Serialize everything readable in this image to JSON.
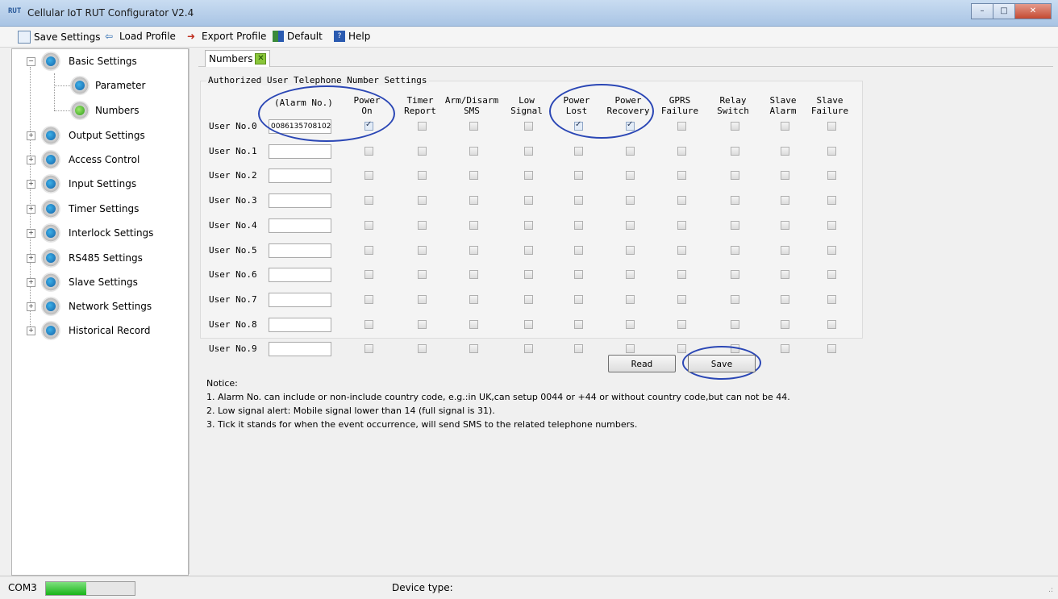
{
  "window": {
    "title": "Cellular IoT RUT Configurator V2.4",
    "min": "–",
    "max": "□",
    "close": "✕"
  },
  "menu": {
    "save_settings": "Save Settings",
    "load_profile": "Load Profile",
    "export_profile": "Export Profile",
    "default": "Default",
    "help": "Help"
  },
  "tree": {
    "basic_settings": "Basic Settings",
    "parameter": "Parameter",
    "numbers": "Numbers",
    "output_settings": "Output Settings",
    "access_control": "Access Control",
    "input_settings": "Input Settings",
    "timer_settings": "Timer Settings",
    "interlock_settings": "Interlock Settings",
    "rs485_settings": "RS485 Settings",
    "slave_settings": "Slave Settings",
    "network_settings": "Network Settings",
    "historical_record": "Historical Record"
  },
  "tab": {
    "label": "Numbers"
  },
  "form": {
    "group_title": "Authorized User Telephone Number Settings",
    "alarm_header": "(Alarm No.)",
    "columns": [
      [
        "Power",
        "On"
      ],
      [
        "Timer",
        "Report"
      ],
      [
        "Arm/Disarm",
        "SMS"
      ],
      [
        "Low",
        "Signal"
      ],
      [
        "Power",
        "Lost"
      ],
      [
        "Power",
        "Recovery"
      ],
      [
        "GPRS",
        "Failure"
      ],
      [
        "Relay",
        "Switch"
      ],
      [
        "Slave",
        "Alarm"
      ],
      [
        "Slave",
        "Failure"
      ]
    ],
    "users": [
      {
        "label": "User No.0",
        "phone": "0086135708102§",
        "checks": [
          true,
          false,
          false,
          false,
          true,
          true,
          false,
          false,
          false,
          false
        ]
      },
      {
        "label": "User No.1",
        "phone": "",
        "checks": [
          false,
          false,
          false,
          false,
          false,
          false,
          false,
          false,
          false,
          false
        ]
      },
      {
        "label": "User No.2",
        "phone": "",
        "checks": [
          false,
          false,
          false,
          false,
          false,
          false,
          false,
          false,
          false,
          false
        ]
      },
      {
        "label": "User No.3",
        "phone": "",
        "checks": [
          false,
          false,
          false,
          false,
          false,
          false,
          false,
          false,
          false,
          false
        ]
      },
      {
        "label": "User No.4",
        "phone": "",
        "checks": [
          false,
          false,
          false,
          false,
          false,
          false,
          false,
          false,
          false,
          false
        ]
      },
      {
        "label": "User No.5",
        "phone": "",
        "checks": [
          false,
          false,
          false,
          false,
          false,
          false,
          false,
          false,
          false,
          false
        ]
      },
      {
        "label": "User No.6",
        "phone": "",
        "checks": [
          false,
          false,
          false,
          false,
          false,
          false,
          false,
          false,
          false,
          false
        ]
      },
      {
        "label": "User No.7",
        "phone": "",
        "checks": [
          false,
          false,
          false,
          false,
          false,
          false,
          false,
          false,
          false,
          false
        ]
      },
      {
        "label": "User No.8",
        "phone": "",
        "checks": [
          false,
          false,
          false,
          false,
          false,
          false,
          false,
          false,
          false,
          false
        ]
      },
      {
        "label": "User No.9",
        "phone": "",
        "checks": [
          false,
          false,
          false,
          false,
          false,
          false,
          false,
          false,
          false,
          false
        ]
      }
    ],
    "read_label": "Read",
    "save_label": "Save"
  },
  "notice": {
    "title": "Notice:",
    "line1": "1. Alarm No. can include or non-include country code, e.g.:in UK,can setup 0044 or +44 or without country code,but can not be 44.",
    "line2": "2. Low signal alert: Mobile signal lower than 14 (full signal is 31).",
    "line3": "3. Tick it stands for when the event occurrence, will send SMS to the related telephone numbers."
  },
  "status": {
    "port": "COM3",
    "progress": 0.45,
    "device_type": "Device type:"
  },
  "colors": {
    "annotation": "#2b47b5",
    "progress_fill": "#18b418",
    "gear_blue": "#1462a8"
  }
}
